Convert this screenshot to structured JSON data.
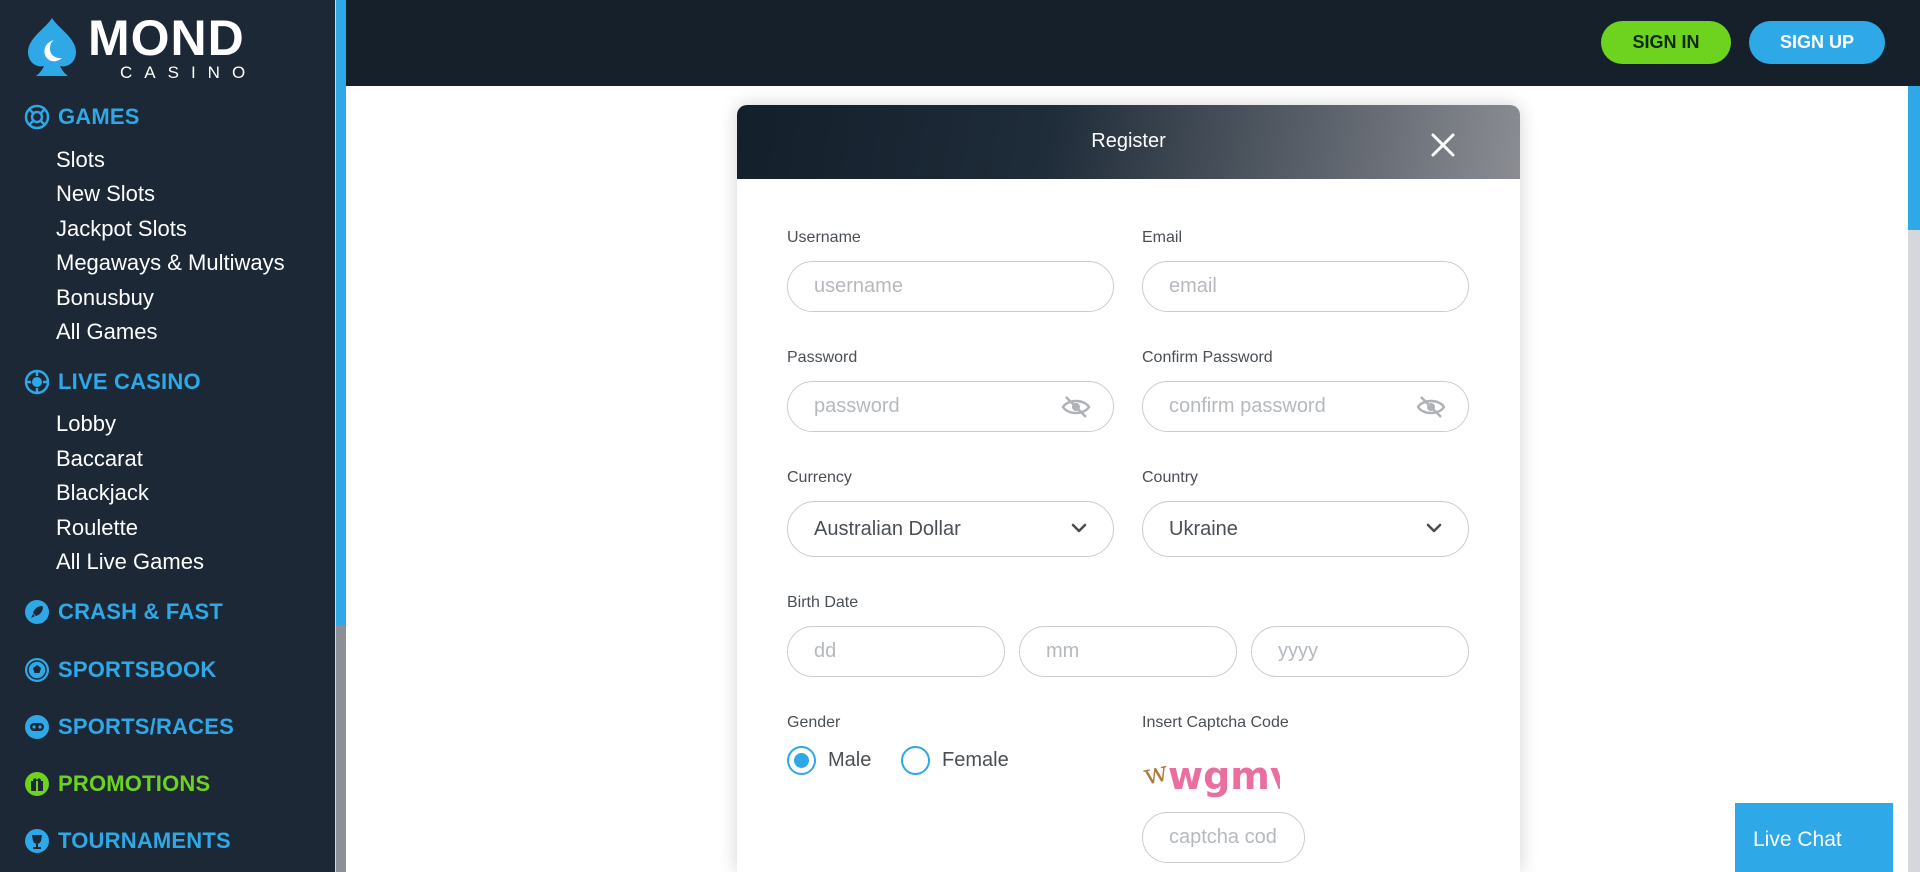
{
  "brand": {
    "logo_main": "MOND",
    "logo_sub": "CASINO"
  },
  "colors": {
    "accent_blue": "#2ea8e6",
    "accent_green": "#6ed31f",
    "sidebar_bg": "#1c2835",
    "header_bg": "#15202b"
  },
  "sidebar": {
    "games": {
      "label": "GAMES",
      "icon": "lifebuoy-icon",
      "items": [
        "Slots",
        "New Slots",
        "Jackpot Slots",
        "Megaways & Multiways",
        "Bonusbuy",
        "All Games"
      ]
    },
    "live_casino": {
      "label": "LIVE CASINO",
      "icon": "casino-chip-icon",
      "items": [
        "Lobby",
        "Baccarat",
        "Blackjack",
        "Roulette",
        "All Live Games"
      ]
    },
    "crash_fast": {
      "label": "CRASH & FAST",
      "icon": "rocket-icon"
    },
    "sportsbook": {
      "label": "SPORTSBOOK",
      "icon": "soccer-ball-icon"
    },
    "sports_races": {
      "label": "SPORTS/RACES",
      "icon": "gamepad-icon"
    },
    "promotions": {
      "label": "PROMOTIONS",
      "icon": "gift-icon"
    },
    "tournaments": {
      "label": "TOURNAMENTS",
      "icon": "trophy-icon"
    }
  },
  "header": {
    "sign_in": "SIGN IN",
    "sign_up": "SIGN UP"
  },
  "modal": {
    "title": "Register",
    "username": {
      "label": "Username",
      "placeholder": "username"
    },
    "email": {
      "label": "Email",
      "placeholder": "email"
    },
    "password": {
      "label": "Password",
      "placeholder": "password"
    },
    "confirm_password": {
      "label": "Confirm Password",
      "placeholder": "confirm password"
    },
    "currency": {
      "label": "Currency",
      "value": "Australian Dollar"
    },
    "country": {
      "label": "Country",
      "value": "Ukraine"
    },
    "birth_date": {
      "label": "Birth Date",
      "day_placeholder": "dd",
      "month_placeholder": "mm",
      "year_placeholder": "yyyy"
    },
    "gender": {
      "label": "Gender",
      "options": [
        "Male",
        "Female"
      ],
      "selected": "Male"
    },
    "captcha": {
      "label": "Insert Captcha Code",
      "code_text": "wgmvc",
      "placeholder": "captcha code"
    }
  },
  "live_chat": {
    "label": "Live Chat"
  }
}
